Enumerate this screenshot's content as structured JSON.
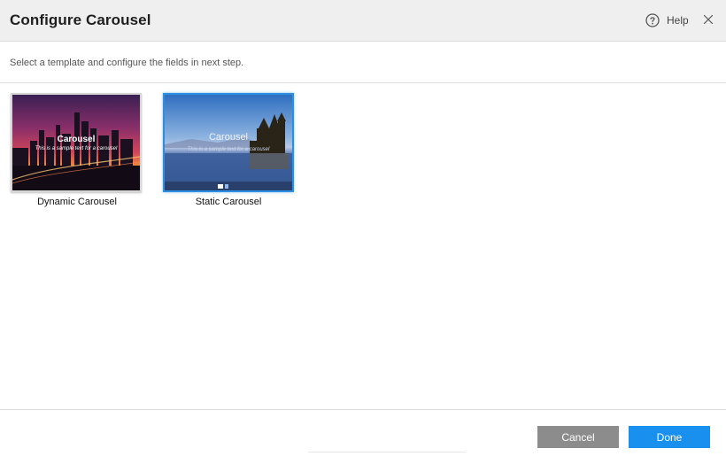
{
  "dialog": {
    "title": "Configure Carousel",
    "help_label": "Help",
    "instructions": "Select a template and configure the fields in next step."
  },
  "templates": [
    {
      "label": "Dynamic Carousel",
      "thumb_title": "Carousel",
      "thumb_subtitle": "This is a sample text for a carousel",
      "selected": false
    },
    {
      "label": "Static Carousel",
      "thumb_title": "Carousel",
      "thumb_subtitle": "This is a sample text for a carousel",
      "selected": true
    }
  ],
  "footer": {
    "cancel_label": "Cancel",
    "done_label": "Done"
  },
  "icons": {
    "help": "help-circle-icon",
    "close": "close-icon",
    "settings": "gear-icon"
  },
  "colors": {
    "header_bg": "#efefef",
    "primary": "#1a90ee",
    "cancel": "#8c8c8c",
    "selected_border": "#2d8fe0"
  }
}
